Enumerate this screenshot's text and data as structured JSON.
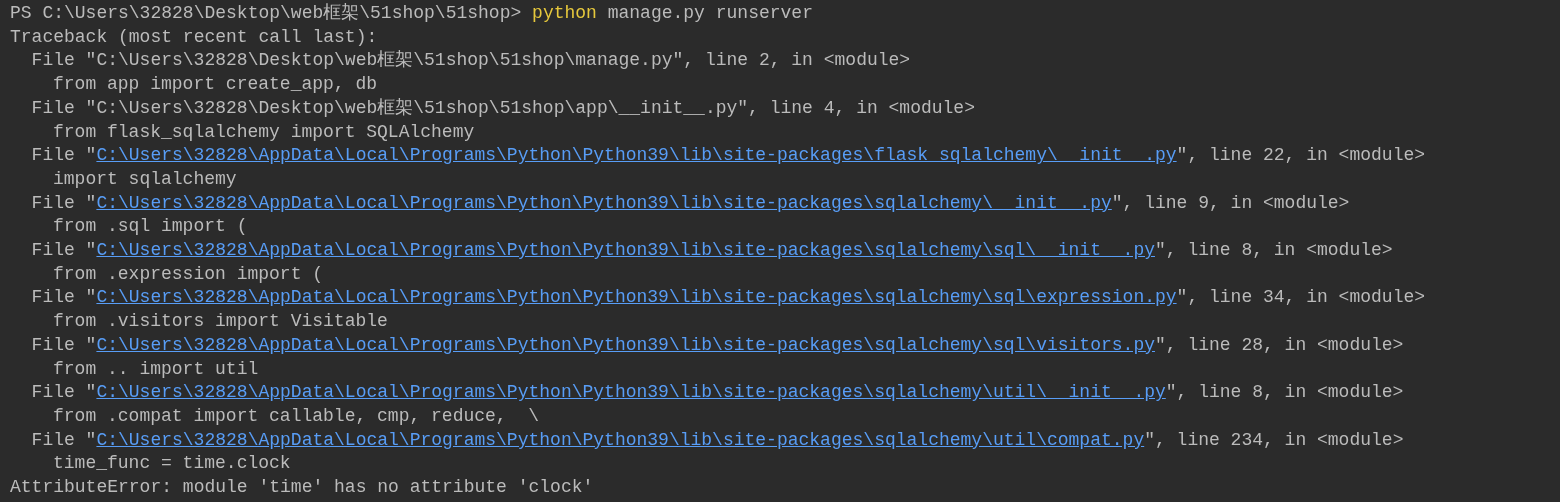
{
  "terminal": {
    "lines": [
      {
        "kind": "prompt",
        "prompt": "PS C:\\Users\\32828\\Desktop\\web框架\\51shop\\51shop>",
        "command": "python",
        "args": " manage.py runserver"
      },
      {
        "kind": "text",
        "text": "Traceback (most recent call last):"
      },
      {
        "kind": "frame",
        "prefix": "File \"",
        "path": "C:\\Users\\32828\\Desktop\\web框架\\51shop\\51shop\\manage.py",
        "suffix": "\", line 2, in <module>",
        "linked": false
      },
      {
        "kind": "code",
        "text": "from app import create_app, db"
      },
      {
        "kind": "frame",
        "prefix": "File \"",
        "path": "C:\\Users\\32828\\Desktop\\web框架\\51shop\\51shop\\app\\__init__.py",
        "suffix": "\", line 4, in <module>",
        "linked": false
      },
      {
        "kind": "code",
        "text": "from flask_sqlalchemy import SQLAlchemy"
      },
      {
        "kind": "frame",
        "prefix": "File \"",
        "path": "C:\\Users\\32828\\AppData\\Local\\Programs\\Python\\Python39\\lib\\site-packages\\flask_sqlalchemy\\__init__.py",
        "suffix": "\", line 22, in <module>",
        "linked": true
      },
      {
        "kind": "code",
        "text": "import sqlalchemy"
      },
      {
        "kind": "frame",
        "prefix": "File \"",
        "path": "C:\\Users\\32828\\AppData\\Local\\Programs\\Python\\Python39\\lib\\site-packages\\sqlalchemy\\__init__.py",
        "suffix": "\", line 9, in <module>",
        "linked": true
      },
      {
        "kind": "code",
        "text": "from .sql import ("
      },
      {
        "kind": "frame",
        "prefix": "File \"",
        "path": "C:\\Users\\32828\\AppData\\Local\\Programs\\Python\\Python39\\lib\\site-packages\\sqlalchemy\\sql\\__init__.py",
        "suffix": "\", line 8, in <module>",
        "linked": true
      },
      {
        "kind": "code",
        "text": "from .expression import ("
      },
      {
        "kind": "frame",
        "prefix": "File \"",
        "path": "C:\\Users\\32828\\AppData\\Local\\Programs\\Python\\Python39\\lib\\site-packages\\sqlalchemy\\sql\\expression.py",
        "suffix": "\", line 34, in <module>",
        "linked": true
      },
      {
        "kind": "code",
        "text": "from .visitors import Visitable"
      },
      {
        "kind": "frame",
        "prefix": "File \"",
        "path": "C:\\Users\\32828\\AppData\\Local\\Programs\\Python\\Python39\\lib\\site-packages\\sqlalchemy\\sql\\visitors.py",
        "suffix": "\", line 28, in <module>",
        "linked": true
      },
      {
        "kind": "code",
        "text": "from .. import util"
      },
      {
        "kind": "frame",
        "prefix": "File \"",
        "path": "C:\\Users\\32828\\AppData\\Local\\Programs\\Python\\Python39\\lib\\site-packages\\sqlalchemy\\util\\__init__.py",
        "suffix": "\", line 8, in <module>",
        "linked": true
      },
      {
        "kind": "code",
        "text": "from .compat import callable, cmp, reduce,  \\"
      },
      {
        "kind": "frame",
        "prefix": "File \"",
        "path": "C:\\Users\\32828\\AppData\\Local\\Programs\\Python\\Python39\\lib\\site-packages\\sqlalchemy\\util\\compat.py",
        "suffix": "\", line 234, in <module>",
        "linked": true
      },
      {
        "kind": "code",
        "text": "time_func = time.clock"
      },
      {
        "kind": "text",
        "text": "AttributeError: module 'time' has no attribute 'clock'"
      }
    ]
  }
}
